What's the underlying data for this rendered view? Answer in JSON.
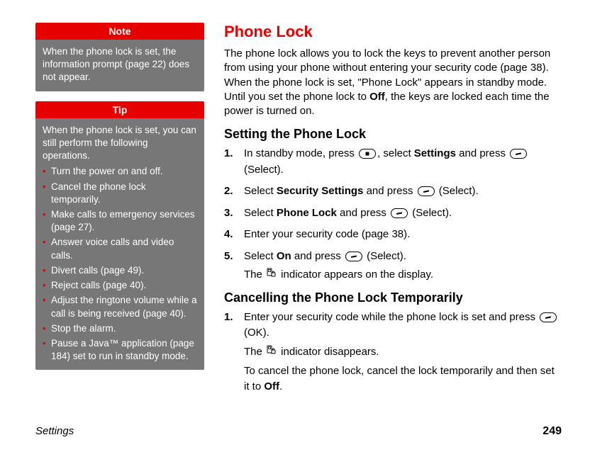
{
  "sidebar": {
    "note": {
      "header": "Note",
      "body": "When the phone lock is set, the information prompt (page 22) does not appear."
    },
    "tip": {
      "header": "Tip",
      "intro": "When the phone lock is set, you can still perform the following operations.",
      "items": [
        "Turn the power on and off.",
        "Cancel the phone lock temporarily.",
        "Make calls to emergency services (page 27).",
        "Answer voice calls and video calls.",
        "Divert calls (page 49).",
        "Reject calls (page 40).",
        "Adjust the ringtone volume while a call is being received (page 40).",
        "Stop the alarm.",
        "Pause a Java™ application (page 184) set to run in standby mode."
      ]
    }
  },
  "main": {
    "title": "Phone Lock",
    "intro_parts": {
      "p1": "The phone lock allows you to lock the keys to prevent another person from using your phone without entering your security code (page 38). When the phone lock is set, \"Phone Lock\" appears in standby mode. Until you set the phone lock to ",
      "off": "Off",
      "p2": ", the keys are locked each time the power is turned on."
    },
    "section1": {
      "heading": "Setting the Phone Lock",
      "steps": [
        {
          "pre": "In standby mode, press ",
          "mid1": ", select ",
          "b1": "Settings",
          "mid2": " and press ",
          "post": " (Select)."
        },
        {
          "pre": "Select ",
          "b1": "Security Settings",
          "mid": " and press ",
          "post": " (Select)."
        },
        {
          "pre": "Select ",
          "b1": "Phone Lock",
          "mid": " and press ",
          "post": " (Select)."
        },
        {
          "text": "Enter your security code (page 38)."
        },
        {
          "pre": "Select ",
          "b1": "On",
          "mid": " and press ",
          "post": " (Select).",
          "sub_pre": "The ",
          "sub_post": " indicator appears on the display."
        }
      ]
    },
    "section2": {
      "heading": "Cancelling the Phone Lock Temporarily",
      "step1_pre": "Enter your security code while the phone lock is set and press ",
      "step1_post": " (OK).",
      "sub1_pre": "The ",
      "sub1_post": " indicator disappears.",
      "sub2_pre": "To cancel the phone lock, cancel the lock temporarily and then set it to ",
      "sub2_b": "Off",
      "sub2_post": "."
    }
  },
  "footer": {
    "chapter": "Settings",
    "page": "249"
  }
}
